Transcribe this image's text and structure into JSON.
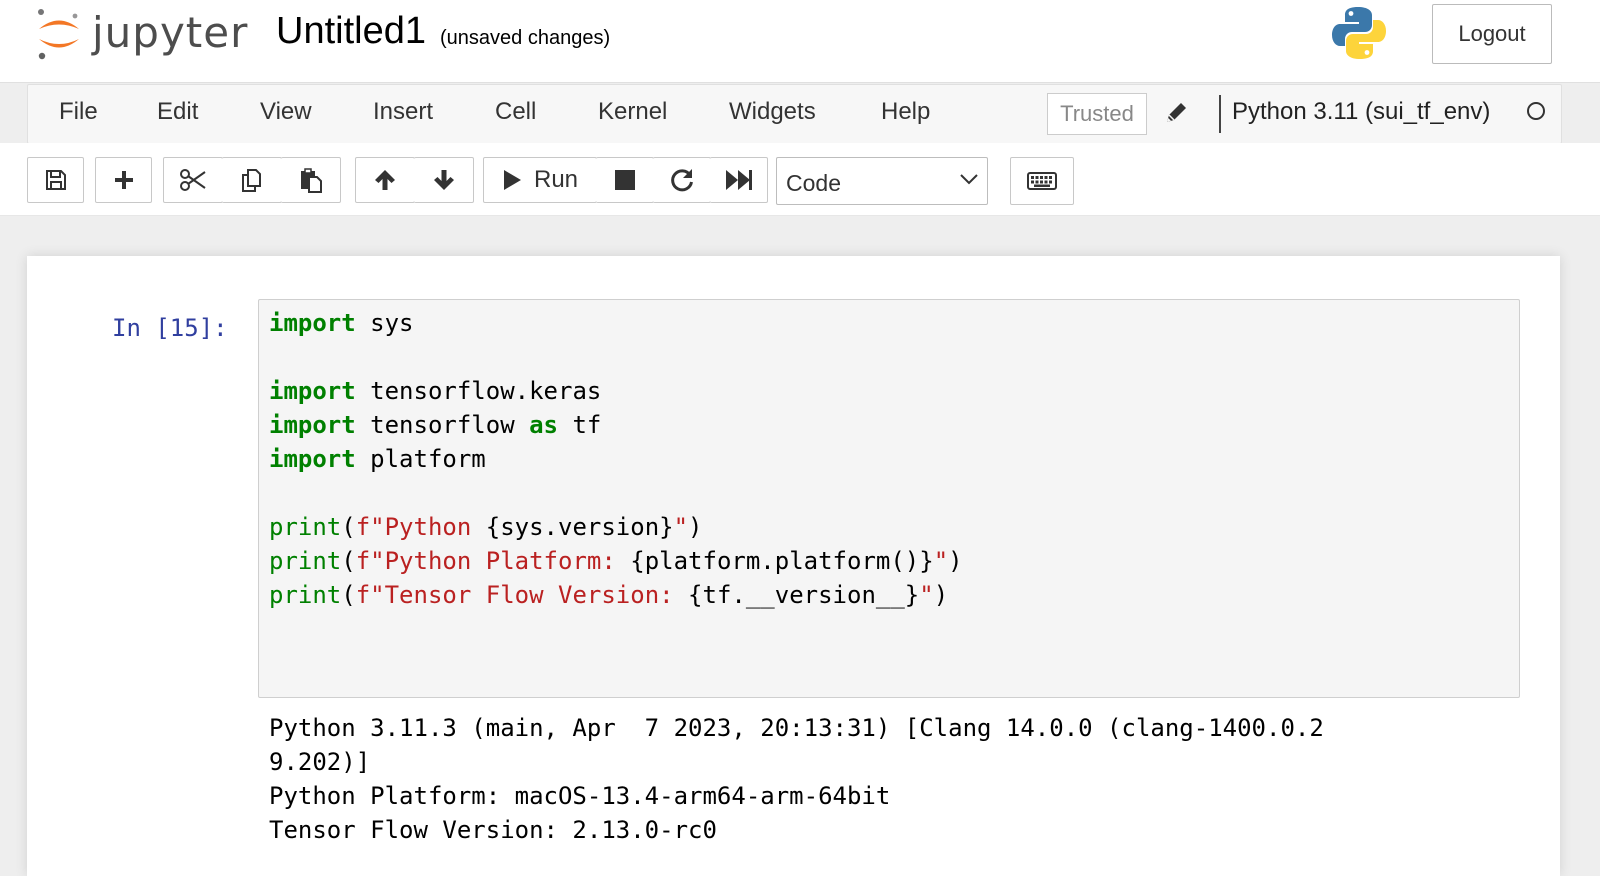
{
  "header": {
    "logo_text": "jupyter",
    "notebook_name": "Untitled1",
    "save_status": "(unsaved changes)",
    "logout_label": "Logout"
  },
  "menubar": {
    "items": [
      "File",
      "Edit",
      "View",
      "Insert",
      "Cell",
      "Kernel",
      "Widgets",
      "Help"
    ],
    "trusted_label": "Trusted",
    "kernel_name": "Python 3.11 (sui_tf_env)"
  },
  "toolbar": {
    "buttons": [
      "save-icon",
      "plus-icon",
      "cut-icon",
      "copy-icon",
      "paste-icon",
      "arrow-up-icon",
      "arrow-down-icon",
      "run-icon",
      "stop-icon",
      "restart-icon",
      "fast-forward-icon",
      "keyboard-icon"
    ],
    "run_label": "Run",
    "cell_type": "Code"
  },
  "cell": {
    "prompt": "In [15]:",
    "code_lines": [
      [
        {
          "t": "import",
          "c": "kw"
        },
        {
          "t": " sys",
          "c": ""
        }
      ],
      [],
      [
        {
          "t": "import",
          "c": "kw"
        },
        {
          "t": " tensorflow.keras",
          "c": ""
        }
      ],
      [
        {
          "t": "import",
          "c": "kw"
        },
        {
          "t": " tensorflow ",
          "c": ""
        },
        {
          "t": "as",
          "c": "kw"
        },
        {
          "t": " tf",
          "c": ""
        }
      ],
      [
        {
          "t": "import",
          "c": "kw"
        },
        {
          "t": " platform",
          "c": ""
        }
      ],
      [],
      [
        {
          "t": "print",
          "c": "bi"
        },
        {
          "t": "(",
          "c": ""
        },
        {
          "t": "f\"Python ",
          "c": "str"
        },
        {
          "t": "{sys.version}",
          "c": ""
        },
        {
          "t": "\"",
          "c": "str"
        },
        {
          "t": ")",
          "c": ""
        }
      ],
      [
        {
          "t": "print",
          "c": "bi"
        },
        {
          "t": "(",
          "c": ""
        },
        {
          "t": "f\"Python Platform: ",
          "c": "str"
        },
        {
          "t": "{platform.platform()}",
          "c": ""
        },
        {
          "t": "\"",
          "c": "str"
        },
        {
          "t": ")",
          "c": ""
        }
      ],
      [
        {
          "t": "print",
          "c": "bi"
        },
        {
          "t": "(",
          "c": ""
        },
        {
          "t": "f\"Tensor Flow Version: ",
          "c": "str"
        },
        {
          "t": "{tf.__version__}",
          "c": ""
        },
        {
          "t": "\"",
          "c": "str"
        },
        {
          "t": ")",
          "c": ""
        }
      ]
    ],
    "output_lines": [
      "Python 3.11.3 (main, Apr  7 2023, 20:13:31) [Clang 14.0.0 (clang-1400.0.2",
      "9.202)]",
      "Python Platform: macOS-13.4-arm64-arm-64bit",
      "Tensor Flow Version: 2.13.0-rc0"
    ]
  },
  "colors": {
    "keyword": "#008000",
    "string": "#ba2121",
    "prompt": "#303f9f",
    "logo_orange": "#f37726"
  }
}
